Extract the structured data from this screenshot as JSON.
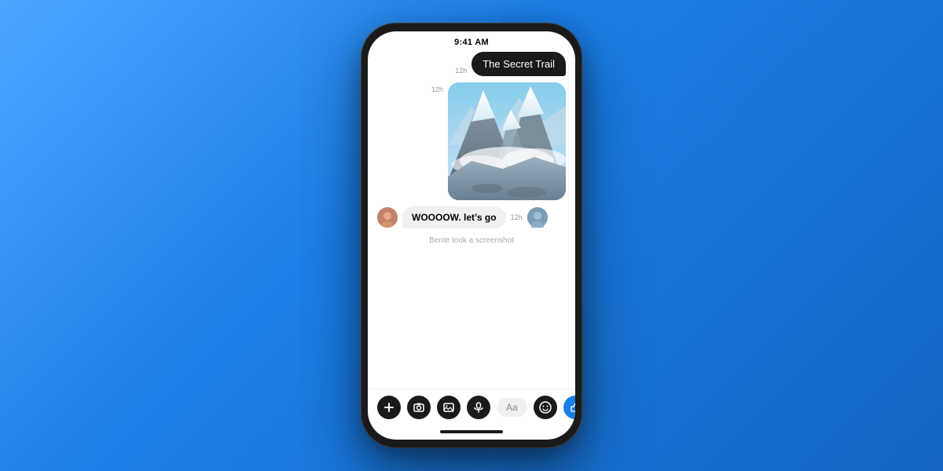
{
  "background": {
    "gradient_start": "#4da6ff",
    "gradient_end": "#1565c0"
  },
  "phone": {
    "status_bar": {
      "time": "9:41 AM"
    },
    "chat": {
      "messages": [
        {
          "type": "outgoing_text",
          "time": "12h",
          "text": "The Secret Trail"
        },
        {
          "type": "outgoing_image",
          "time": "12h",
          "alt": "Mountain trail landscape"
        },
        {
          "type": "incoming_text",
          "time": "12h",
          "text": "WOOOOW. let’s go"
        },
        {
          "type": "notice",
          "text": "Bente took a screenshot"
        }
      ]
    },
    "toolbar": {
      "input_placeholder": "Aa",
      "icons": [
        "plus",
        "camera",
        "image",
        "microphone",
        "emoji",
        "thumbs-up"
      ]
    }
  }
}
